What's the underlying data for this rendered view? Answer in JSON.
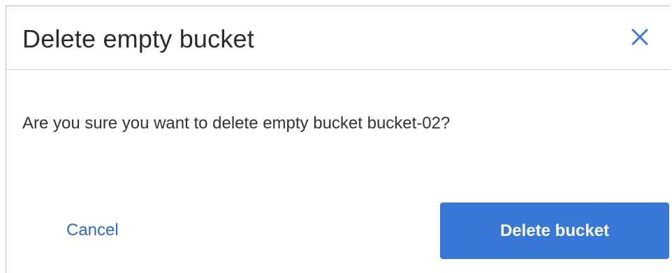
{
  "dialog": {
    "title": "Delete empty bucket",
    "close_icon": "close-icon",
    "message": "Are you sure you want to delete empty bucket bucket-02?",
    "cancel_label": "Cancel",
    "confirm_label": "Delete bucket"
  },
  "colors": {
    "primary": "#3a78d8",
    "link": "#2d6bc7",
    "close_icon": "#3a78d8"
  }
}
